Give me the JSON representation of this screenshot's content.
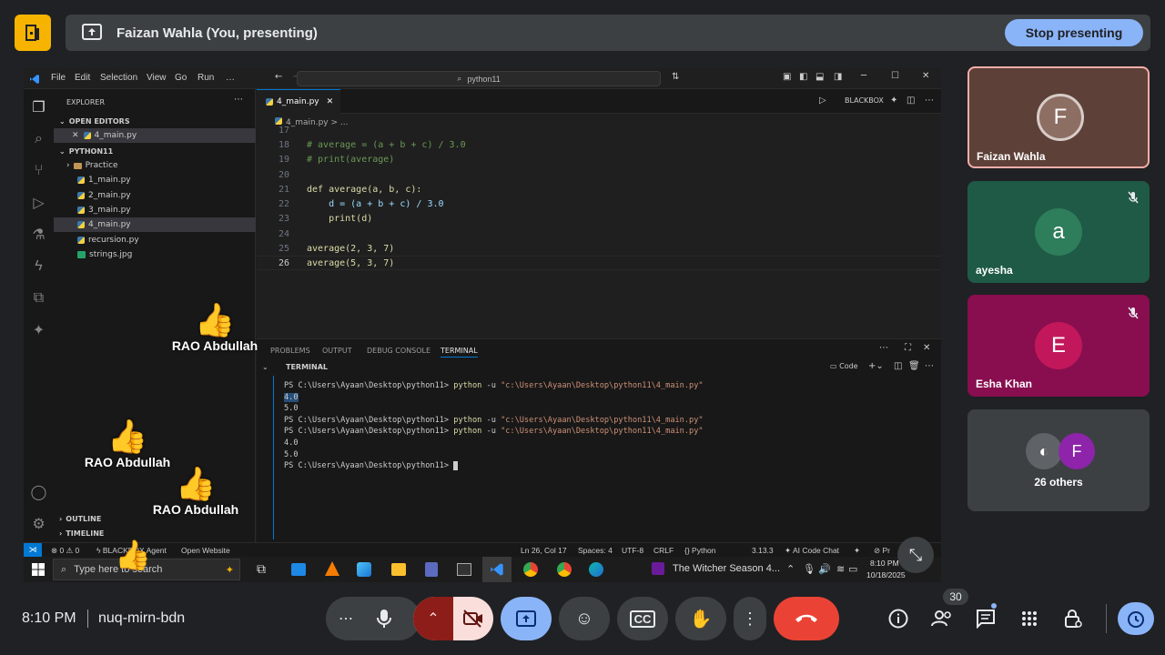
{
  "present_bar": {
    "title": "Faizan Wahla (You, presenting)",
    "stop_label": "Stop presenting"
  },
  "vscode": {
    "menu": [
      "File",
      "Edit",
      "Selection",
      "View",
      "Go",
      "Run",
      "…"
    ],
    "search": "python11",
    "blackbox_label": "BLACKBOX",
    "explorer_title": "EXPLORER",
    "open_editors_label": "OPEN EDITORS",
    "open_editor_file": "4_main.py",
    "project_label": "PYTHON11",
    "files": [
      "Practice",
      "1_main.py",
      "2_main.py",
      "3_main.py",
      "4_main.py",
      "recursion.py",
      "strings.jpg"
    ],
    "outline_label": "OUTLINE",
    "timeline_label": "TIMELINE",
    "tab_label": "4_main.py",
    "breadcrumb": "4_main.py > ...",
    "code_lines": [
      {
        "n": "17",
        "text": ""
      },
      {
        "n": "18",
        "text": "# average = (a + b + c) / 3.0"
      },
      {
        "n": "19",
        "text": "# print(average)"
      },
      {
        "n": "20",
        "text": ""
      },
      {
        "n": "21",
        "text": "def average(a, b, c):"
      },
      {
        "n": "22",
        "text": "    d = (a + b + c) / 3.0"
      },
      {
        "n": "23",
        "text": "    print(d)"
      },
      {
        "n": "24",
        "text": ""
      },
      {
        "n": "25",
        "text": "average(2, 3, 7)"
      },
      {
        "n": "26",
        "text": "average(5, 3, 7)"
      }
    ],
    "panel_tabs": [
      "PROBLEMS",
      "OUTPUT",
      "DEBUG CONSOLE",
      "TERMINAL"
    ],
    "terminal_header": "TERMINAL",
    "terminal_code_label": "Code",
    "terminal": {
      "prompt": "PS C:\\Users\\Ayaan\\Desktop\\python11>",
      "cmd": "python",
      "flag": "-u",
      "path": "\"c:\\Users\\Ayaan\\Desktop\\python11\\4_main.py\"",
      "out1": "4.0",
      "out2": "5.0"
    },
    "status": {
      "errors": "⊗ 0 ⚠ 0",
      "agent": "BLACKBOX Agent",
      "open_website": "Open Website",
      "position": "Ln 26, Col 17",
      "spaces": "Spaces: 4",
      "encoding": "UTF-8",
      "eol": "CRLF",
      "language": "Python",
      "version": "3.13.3",
      "ai_chat": "AI Code Chat",
      "prettier": "Pr"
    },
    "taskbar": {
      "search_placeholder": "Type here to search",
      "media": "The Witcher Season 4...",
      "time": "8:10 PM",
      "date": "10/18/2025"
    }
  },
  "reactions": [
    {
      "name": "RAO Abdullah"
    },
    {
      "name": "RAO Abdullah"
    },
    {
      "name": "RAO Abdullah"
    }
  ],
  "participants": [
    {
      "initial": "F",
      "name": "Faizan Wahla",
      "color": "#8d6e63"
    },
    {
      "initial": "a",
      "name": "ayesha",
      "color": "#2e7d5b"
    },
    {
      "initial": "E",
      "name": "Esha Khan",
      "color": "#c2185b"
    }
  ],
  "others": {
    "initial": "F",
    "label": "26 others"
  },
  "meeting": {
    "time": "8:10 PM",
    "code": "nuq-mirn-bdn",
    "people_count": "30"
  },
  "colors": {
    "accent": "#8ab4f8",
    "end_call": "#ea4335",
    "camera_off": "#f9dedc",
    "present_active": "#8ab4f8"
  }
}
